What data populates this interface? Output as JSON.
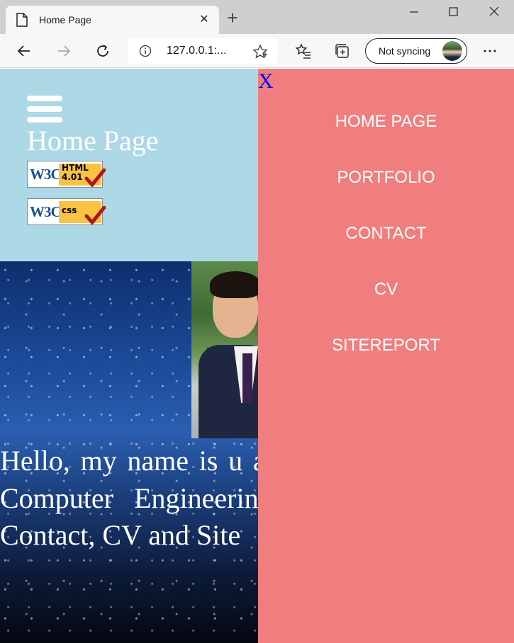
{
  "browser": {
    "tab_title": "Home Page",
    "tab_close": "✕",
    "new_tab": "+",
    "url": "127.0.0.1:...",
    "sync_label": "Not syncing"
  },
  "page": {
    "menu_icon": "hamburger-icon",
    "title": "Home Page",
    "badges": {
      "html": {
        "brand": "W3C",
        "label_line1": "HTML",
        "label_line2": "4.01"
      },
      "css": {
        "brand": "W3C",
        "label_line1": "css"
      }
    },
    "intro_text": "Hello, my name is u am a first year stude Computer Engineerin This website sho Contact, CV and Site"
  },
  "sidenav": {
    "close_label": "X",
    "links": [
      "HOME PAGE",
      "PORTFOLIO",
      "CONTACT",
      "CV",
      "SITEREPORT"
    ]
  },
  "colors": {
    "header_bg": "#add8e6",
    "sidenav_bg": "#f07e7e",
    "close_x": "#0000ff",
    "badge_gold": "#f6c343"
  }
}
